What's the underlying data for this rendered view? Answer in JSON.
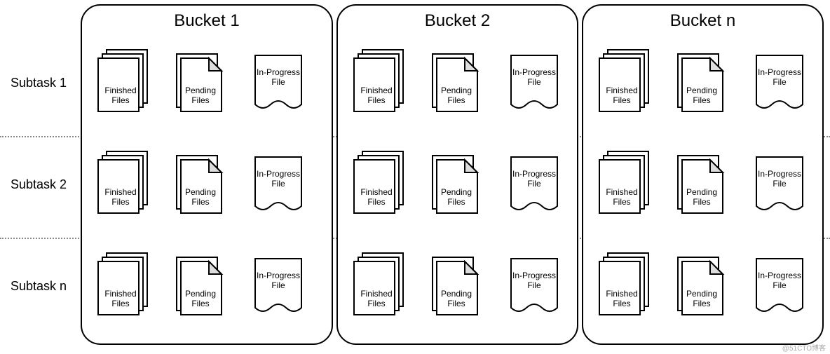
{
  "rows": [
    {
      "label": "Subtask 1"
    },
    {
      "label": "Subtask 2"
    },
    {
      "label": "Subtask n"
    }
  ],
  "buckets": [
    {
      "title": "Bucket 1"
    },
    {
      "title": "Bucket 2"
    },
    {
      "title": "Bucket n"
    }
  ],
  "fileLabels": {
    "finished": "Finished\nFiles",
    "pending": "Pending\nFiles",
    "inprogress": "In-Progress\nFile"
  },
  "watermark": "@51CTO博客"
}
